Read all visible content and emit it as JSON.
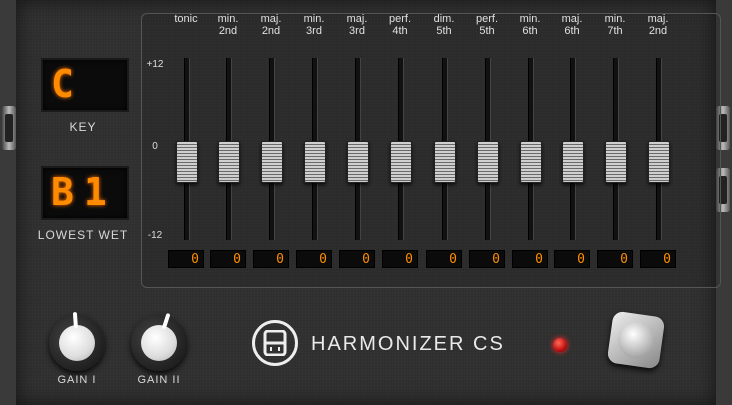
{
  "key": {
    "value": "C",
    "label": "KEY"
  },
  "lowest_wet": {
    "value": "B1",
    "label": "LOWEST WET"
  },
  "scale": {
    "top": "+12",
    "mid": "0",
    "bottom": "-12"
  },
  "intervals": [
    {
      "name": "tonic",
      "value": "0",
      "level": 0
    },
    {
      "name": "min.\n2nd",
      "value": "0",
      "level": 0
    },
    {
      "name": "maj.\n2nd",
      "value": "0",
      "level": 0
    },
    {
      "name": "min.\n3rd",
      "value": "0",
      "level": 0
    },
    {
      "name": "maj.\n3rd",
      "value": "0",
      "level": 0
    },
    {
      "name": "perf.\n4th",
      "value": "0",
      "level": 0
    },
    {
      "name": "dim.\n5th",
      "value": "0",
      "level": 0
    },
    {
      "name": "perf.\n5th",
      "value": "0",
      "level": 0
    },
    {
      "name": "min.\n6th",
      "value": "0",
      "level": 0
    },
    {
      "name": "maj.\n6th",
      "value": "0",
      "level": 0
    },
    {
      "name": "min.\n7th",
      "value": "0",
      "level": 0
    },
    {
      "name": "maj.\n2nd",
      "value": "0",
      "level": 0
    }
  ],
  "knobs": [
    {
      "label": "GAIN I"
    },
    {
      "label": "GAIN II"
    }
  ],
  "brand": "HARMONIZER CS",
  "colors": {
    "display": "#ff8c00",
    "led": "#ff2a2a"
  }
}
